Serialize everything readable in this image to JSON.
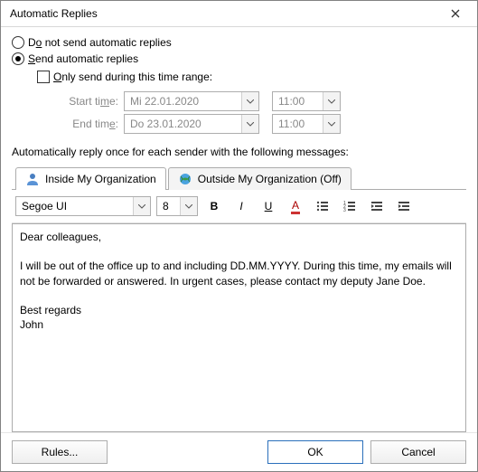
{
  "window": {
    "title": "Automatic Replies"
  },
  "radios": {
    "do_not_send": "Do not send automatic replies",
    "send": "Send automatic replies",
    "selected": "send"
  },
  "range": {
    "only_during_label": "Only send during this time range:",
    "start_label": "Start time:",
    "end_label": "End time:",
    "start_date": "Mi 22.01.2020",
    "start_time": "11:00",
    "end_date": "Do 23.01.2020",
    "end_time": "11:00"
  },
  "section_label": "Automatically reply once for each sender with the following messages:",
  "tabs": {
    "inside": "Inside My Organization",
    "outside": "Outside My Organization (Off)"
  },
  "format": {
    "font": "Segoe UI",
    "size": "8"
  },
  "message": "Dear colleagues,\n\nI will be out of the office up to and including DD.MM.YYYY. During this time, my emails will not be forwarded or answered. In urgent cases, please contact my deputy Jane Doe.\n\nBest regards\nJohn",
  "footer": {
    "rules": "Rules...",
    "ok": "OK",
    "cancel": "Cancel"
  }
}
